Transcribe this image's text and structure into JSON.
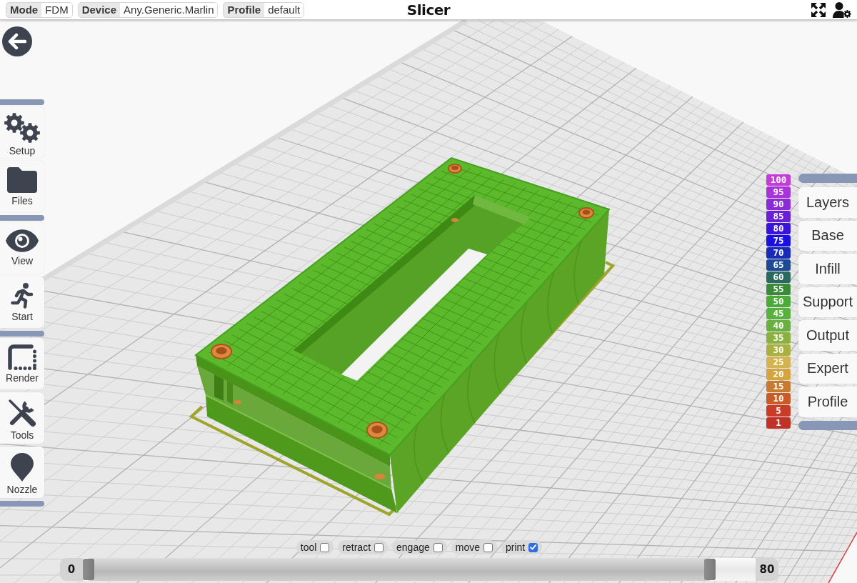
{
  "top_bar": {
    "selectors": [
      {
        "label": "Mode",
        "value": "FDM"
      },
      {
        "label": "Device",
        "value": "Any.Generic.Marlin"
      },
      {
        "label": "Profile",
        "value": "default"
      }
    ],
    "title": "Slicer"
  },
  "sidebar": {
    "groups": [
      {
        "items": [
          {
            "label": "Setup"
          },
          {
            "label": "Files"
          }
        ]
      },
      {
        "items": [
          {
            "label": "View"
          },
          {
            "label": "Start"
          }
        ]
      },
      {
        "items": [
          {
            "label": "Render"
          },
          {
            "label": "Tools"
          },
          {
            "label": "Nozzle"
          }
        ]
      }
    ]
  },
  "layer_legend": [
    {
      "label": "100",
      "color": "#c43cd8"
    },
    {
      "label": "95",
      "color": "#a834d8"
    },
    {
      "label": "90",
      "color": "#8a2ad8"
    },
    {
      "label": "85",
      "color": "#6a1ed8"
    },
    {
      "label": "80",
      "color": "#3a14d8"
    },
    {
      "label": "75",
      "color": "#1a10e0"
    },
    {
      "label": "70",
      "color": "#1a2ab8"
    },
    {
      "label": "65",
      "color": "#1e4a94"
    },
    {
      "label": "60",
      "color": "#2a6a5e"
    },
    {
      "label": "55",
      "color": "#3a8a3a"
    },
    {
      "label": "50",
      "color": "#4aaa3a"
    },
    {
      "label": "45",
      "color": "#58b03e"
    },
    {
      "label": "40",
      "color": "#6ab040"
    },
    {
      "label": "35",
      "color": "#8ab040"
    },
    {
      "label": "30",
      "color": "#a8b040"
    },
    {
      "label": "25",
      "color": "#d4b450"
    },
    {
      "label": "20",
      "color": "#d4a440"
    },
    {
      "label": "15",
      "color": "#c87a30"
    },
    {
      "label": "10",
      "color": "#c85c28"
    },
    {
      "label": "5",
      "color": "#c83c28"
    },
    {
      "label": "1",
      "color": "#c03228"
    }
  ],
  "settings_menu": [
    {
      "label": "Layers"
    },
    {
      "label": "Base"
    },
    {
      "label": "Infill"
    },
    {
      "label": "Support"
    },
    {
      "label": "Output"
    },
    {
      "label": "Expert"
    },
    {
      "label": "Profile"
    }
  ],
  "path_toggles": [
    {
      "label": "tool",
      "checked": false
    },
    {
      "label": "retract",
      "checked": false
    },
    {
      "label": "engage",
      "checked": false
    },
    {
      "label": "move",
      "checked": false
    },
    {
      "label": "print",
      "checked": true
    }
  ],
  "layer_slider": {
    "start_label": "0",
    "end_label": "80",
    "thumbs": [
      {
        "level": 0
      },
      {
        "level": 0.94
      }
    ]
  }
}
